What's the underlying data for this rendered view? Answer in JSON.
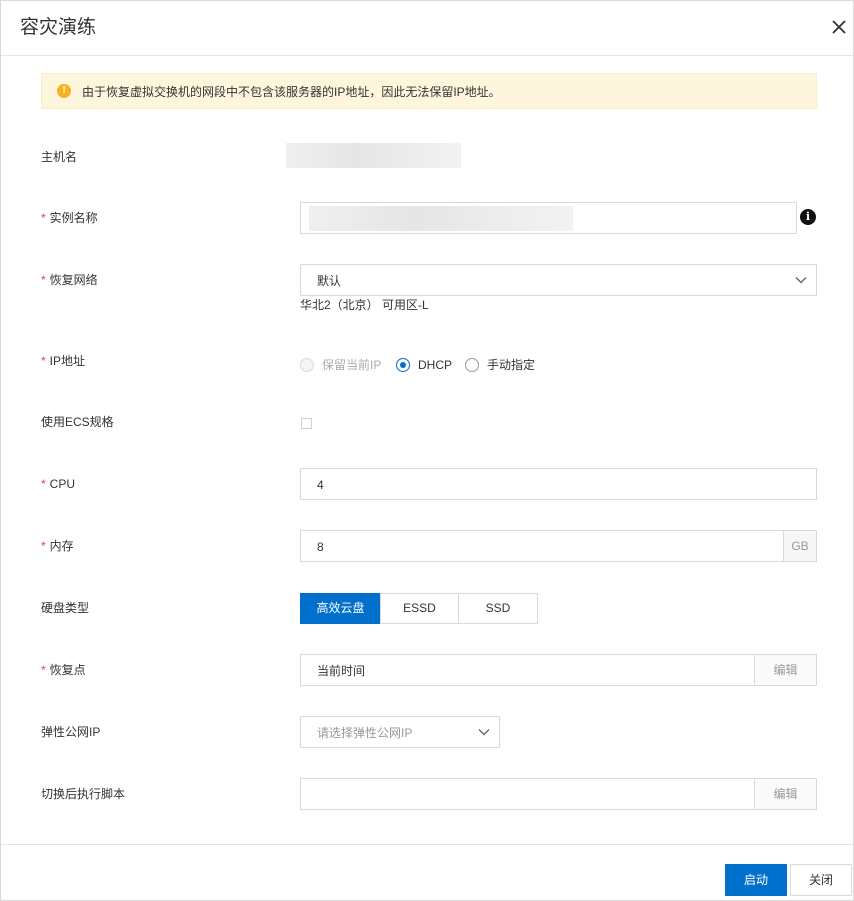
{
  "dialog": {
    "title": "容灾演练"
  },
  "alert": {
    "message": "由于恢复虚拟交换机的网段中不包含该服务器的IP地址，因此无法保留IP地址。",
    "icon": "warning-icon",
    "color": "#f5b225"
  },
  "form": {
    "required_mark": "*",
    "hostname": {
      "label": "主机名",
      "value": ""
    },
    "instance_name": {
      "label": "实例名称",
      "value": ""
    },
    "recovery_network": {
      "label": "恢复网络",
      "selected": "默认",
      "zone_hint": "华北2（北京） 可用区-L"
    },
    "ip_address": {
      "label": "IP地址",
      "options": [
        {
          "label": "保留当前IP",
          "state": "disabled"
        },
        {
          "label": "DHCP",
          "state": "checked"
        },
        {
          "label": "手动指定",
          "state": "unchecked"
        }
      ]
    },
    "use_ecs_spec": {
      "label": "使用ECS规格",
      "checked": false
    },
    "cpu": {
      "label": "CPU",
      "value": "4"
    },
    "memory": {
      "label": "内存",
      "value": "8",
      "unit": "GB"
    },
    "disk_type": {
      "label": "硬盘类型",
      "options": [
        "高效云盘",
        "ESSD",
        "SSD"
      ],
      "selected": "高效云盘"
    },
    "recovery_point": {
      "label": "恢复点",
      "value": "当前时间",
      "edit_label": "编辑"
    },
    "elastic_ip": {
      "label": "弹性公网IP",
      "placeholder": "请选择弹性公网IP"
    },
    "post_script": {
      "label": "切换后执行脚本",
      "value": "",
      "edit_label": "编辑"
    }
  },
  "footer": {
    "start_label": "启动",
    "close_label": "关闭"
  },
  "colors": {
    "primary": "#0070cc",
    "required": "#e04141",
    "alert_bg": "#fdf6dc"
  }
}
